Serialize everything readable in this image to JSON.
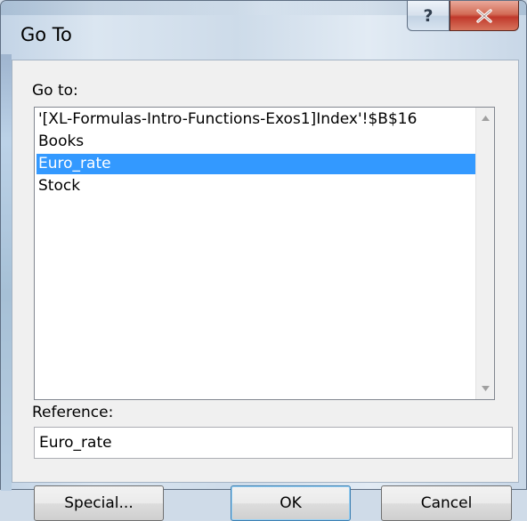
{
  "window": {
    "title": "Go To",
    "help_label": "?"
  },
  "goto": {
    "label": "Go to:",
    "items": [
      {
        "label": "'[XL-Formulas-Intro-Functions-Exos1]Index'!$B$16",
        "selected": false
      },
      {
        "label": "Books",
        "selected": false
      },
      {
        "label": "Euro_rate",
        "selected": true
      },
      {
        "label": "Stock",
        "selected": false
      }
    ]
  },
  "reference": {
    "label": "Reference:",
    "value": "Euro_rate"
  },
  "buttons": {
    "special": "Special...",
    "ok": "OK",
    "cancel": "Cancel"
  },
  "colors": {
    "selection": "#3399ff",
    "close_button": "#c0392b"
  }
}
